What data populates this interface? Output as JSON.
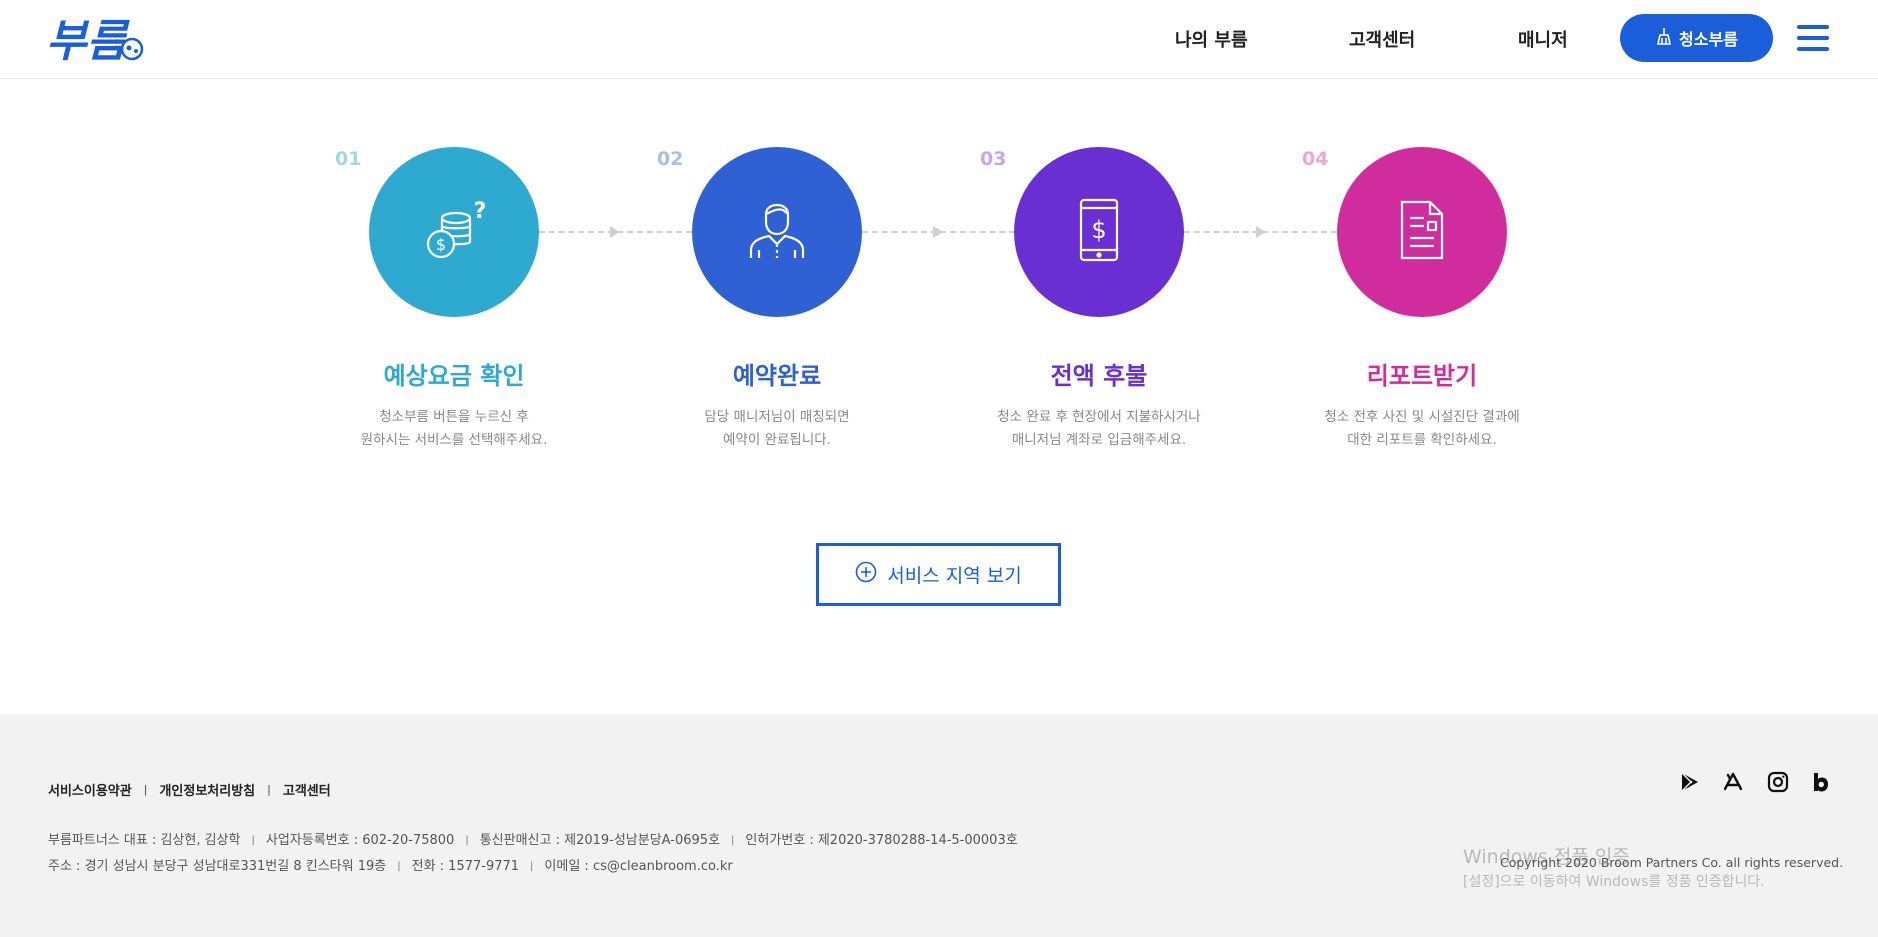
{
  "header": {
    "logo_text": "부름",
    "nav": [
      "나의 부름",
      "고객센터",
      "매니저"
    ],
    "cta_label": "청소부름"
  },
  "colors": {
    "brand": "#1a5fd9",
    "step1": "#2eaad1",
    "step2": "#2f61d5",
    "step3": "#6a2fd3",
    "step4": "#d12c9e"
  },
  "steps": [
    {
      "num": "01",
      "title": "예상요금 확인",
      "desc1": "청소부름 버튼을 누르신 후",
      "desc2": "원하시는 서비스를 선택해주세요.",
      "icon": "coins-question-icon"
    },
    {
      "num": "02",
      "title": "예약완료",
      "desc1": "담당 매니저님이 매칭되면",
      "desc2": "예약이 완료됩니다.",
      "icon": "manager-person-icon"
    },
    {
      "num": "03",
      "title": "전액 후불",
      "desc1": "청소 완료 후 현장에서 지불하시거나",
      "desc2": "매니저님 계좌로 입금해주세요.",
      "icon": "mobile-payment-icon"
    },
    {
      "num": "04",
      "title": "리포트받기",
      "desc1": "청소 전후 사진 및 시설진단 결과에",
      "desc2": "대한 리포트를 확인하세요.",
      "icon": "report-document-icon"
    }
  ],
  "service_area_label": "서비스 지역 보기",
  "footer": {
    "links": [
      "서비스이용약관",
      "개인정보처리방침",
      "고객센터"
    ],
    "info_line1": [
      "부름파트너스 대표 : 김상현, 김상학",
      "사업자등록번호 : 602-20-75800",
      "통신판매신고 : 제2019-성남분당A-0695호",
      "인허가번호 : 제2020-3780288-14-5-00003호"
    ],
    "info_line2": [
      "주소 : 경기 성남시 분당구 성남대로331번길 8 킨스타워 19층",
      "전화 : 1577-9771",
      "이메일 : cs@cleanbroom.co.kr"
    ],
    "social": [
      "google-play-icon",
      "app-store-icon",
      "instagram-icon",
      "blog-icon"
    ],
    "copyright": "Copyright 2020 Broom Partners Co. all rights reserved."
  },
  "watermark": {
    "line1": "Windows 정품 인증",
    "line2": "[설정]으로 이동하여 Windows를 정품 인증합니다."
  }
}
